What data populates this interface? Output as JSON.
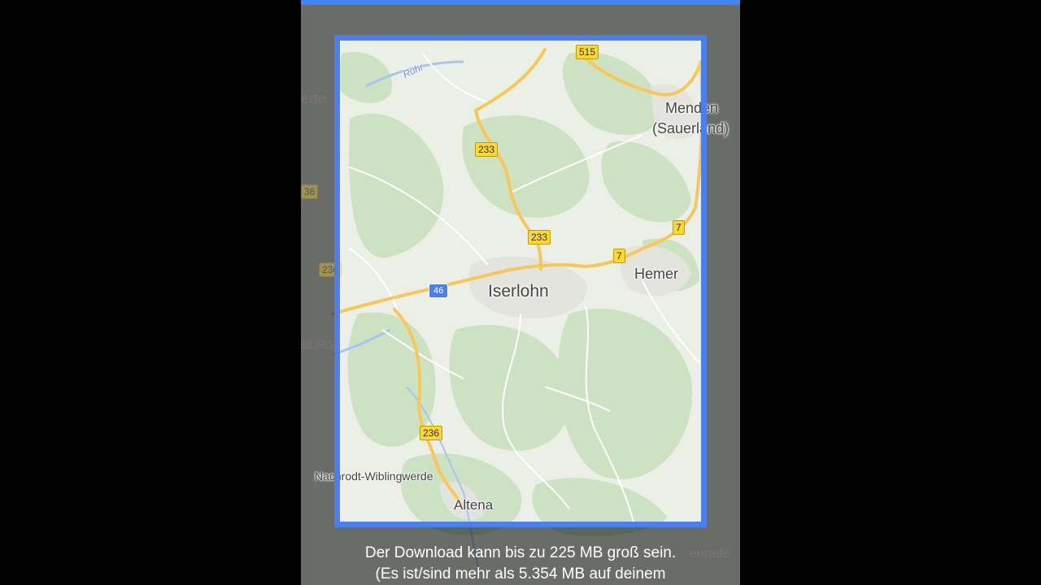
{
  "map": {
    "places": {
      "iserlohn": "Iserlohn",
      "hemer": "Hemer",
      "menden_line1": "Menden",
      "menden_line2": "(Sauerland)",
      "altena": "Altena",
      "nachrodt": "Nachrodt-Wiblingwerde",
      "ruhr": "Ruhr",
      "outside_left_top": "erte",
      "outside_left_burg": "BURG",
      "outside_right_bottom": "enrade"
    },
    "route_shields": {
      "b515": "515",
      "b233_top": "233",
      "b233_mid": "233",
      "b7_right": "7",
      "b7_mid": "7",
      "b236": "236",
      "a46": "46",
      "edge_36": "36",
      "edge_236": "236"
    }
  },
  "download_message": {
    "line1": "Der Download kann bis zu 225 MB groß sein.",
    "line2": "(Es ist/sind mehr als 5.354 MB auf deinem"
  },
  "colors": {
    "accent_blue": "#4285f4",
    "frame_blue": "#4a7fee",
    "road_yellow": "#f6c859",
    "forest_green": "#cfe2c4",
    "urban_gray": "#e8e8e4"
  }
}
